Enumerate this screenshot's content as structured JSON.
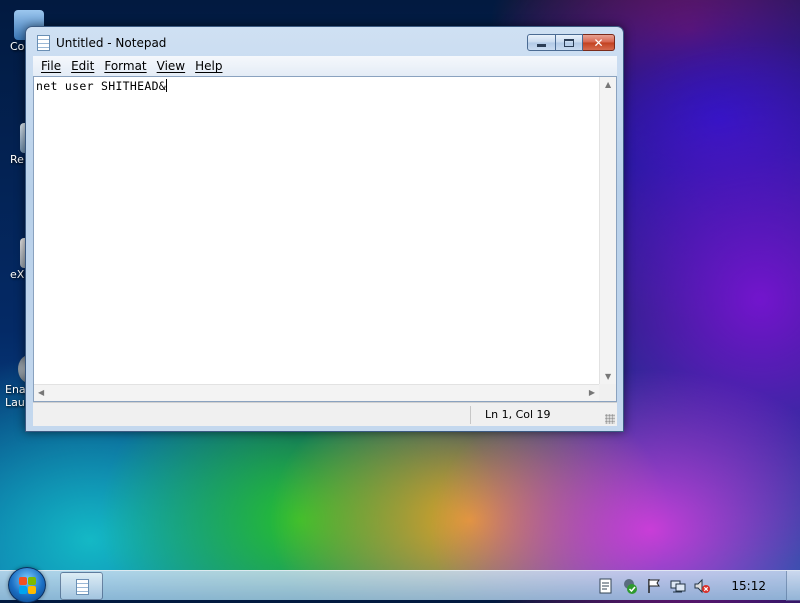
{
  "desktop": {
    "icons": [
      {
        "label": "Co",
        "icon": "computer-icon"
      },
      {
        "label": "Re",
        "icon": "recycle-bin-icon"
      },
      {
        "label": "eX",
        "icon": "shortcut-icon"
      },
      {
        "label": "Ena\nLau",
        "icon": "launcher-icon"
      }
    ]
  },
  "window": {
    "title": "Untitled - Notepad",
    "menu": [
      "File",
      "Edit",
      "Format",
      "View",
      "Help"
    ],
    "content": "net user SHITHEAD&",
    "status": "Ln 1, Col 19"
  },
  "taskbar": {
    "clock": "15:12",
    "tray_icons": [
      "action-center-doc-icon",
      "security-shield-icon",
      "flag-icon",
      "network-icon",
      "volume-muted-icon"
    ]
  },
  "colors": {
    "close_button": "#c2401f",
    "taskbar": "#a9c4e0",
    "window_frame": "#b9d1ea"
  }
}
